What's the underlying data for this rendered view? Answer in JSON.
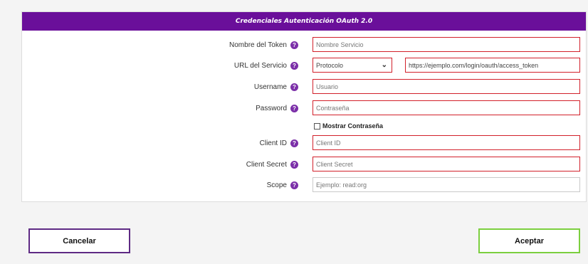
{
  "form": {
    "header": "Credenciales Autenticación OAuth 2.0",
    "help_glyph": "?",
    "fields": {
      "token_name": {
        "label": "Nombre del Token",
        "placeholder": "Nombre Servicio"
      },
      "service_url": {
        "label": "URL del Servicio",
        "protocol_selected": "Protocolo",
        "url_value": "https://ejemplo.com/login/oauth/access_token"
      },
      "username": {
        "label": "Username",
        "placeholder": "Usuario"
      },
      "password": {
        "label": "Password",
        "placeholder": "Contraseña"
      },
      "show_password": {
        "label": "Mostrar Contraseña"
      },
      "client_id": {
        "label": "Client ID",
        "placeholder": "Client ID"
      },
      "client_secret": {
        "label": "Client Secret",
        "placeholder": "Client Secret"
      },
      "scope": {
        "label": "Scope",
        "placeholder": "Ejemplo: read:org"
      }
    }
  },
  "buttons": {
    "cancel": "Cancelar",
    "accept": "Aceptar"
  },
  "icons": {
    "help": "help-circle-icon",
    "dropdown": "chevron-down-icon"
  },
  "colors": {
    "header_bg": "#6a0f9a",
    "required_border": "#d2202a",
    "cancel_border": "#5e2a84",
    "accept_border": "#7ccf3f"
  }
}
